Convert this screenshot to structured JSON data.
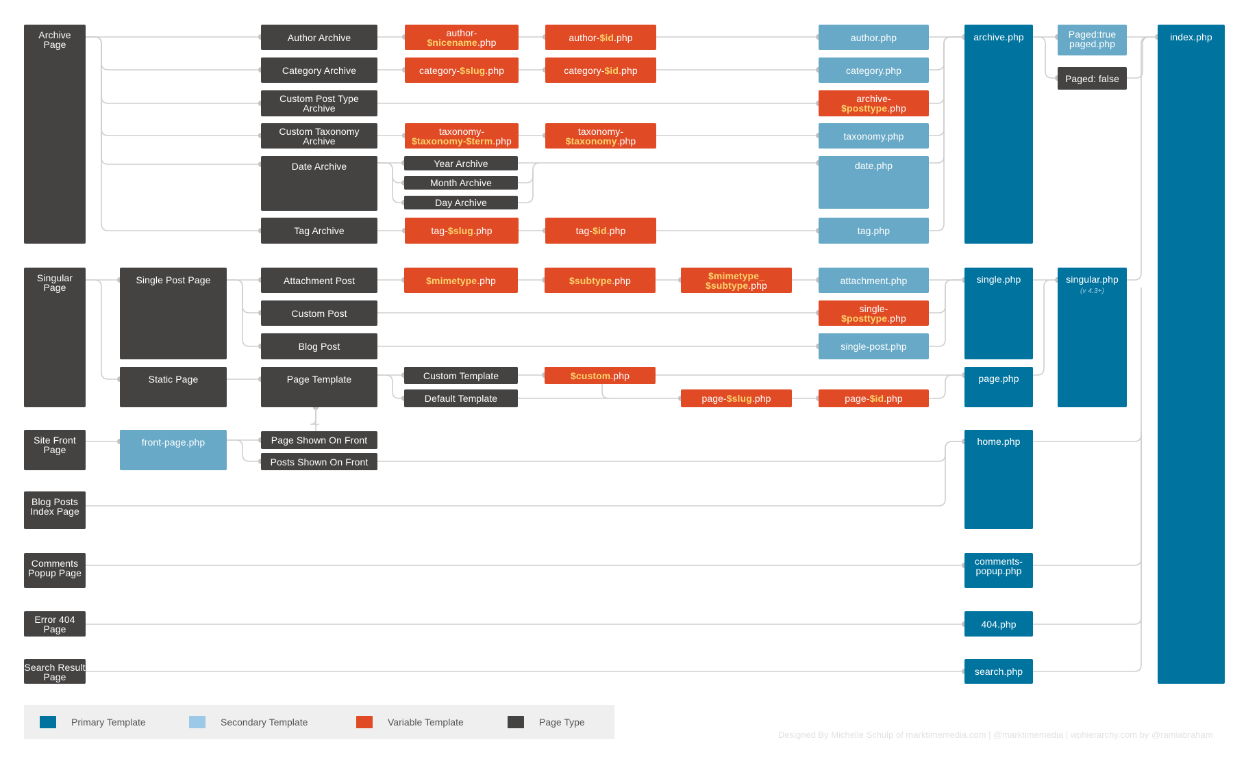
{
  "colors": {
    "primary": "#00739f",
    "secondary": "#67a9c6",
    "variable": "#e04a25",
    "page_type": "#454342",
    "variable_highlight": "#fcd36b",
    "connector": "#cfcfcf"
  },
  "page_types": {
    "archive": [
      "Archive",
      "Page"
    ],
    "singular": [
      "Singular",
      "Page"
    ],
    "site_front": [
      "Site Front",
      "Page"
    ],
    "blog_posts_index": [
      "Blog Posts",
      "Index Page"
    ],
    "comments_popup": [
      "Comments",
      "Popup Page"
    ],
    "error_404": [
      "Error 404",
      "Page"
    ],
    "search_result": [
      "Search Result",
      "Page"
    ]
  },
  "archive_types": {
    "author": "Author Archive",
    "category": "Category Archive",
    "custom_post_type": [
      "Custom Post Type",
      "Archive"
    ],
    "custom_taxonomy": [
      "Custom Taxonomy",
      "Archive"
    ],
    "date": "Date Archive",
    "year": "Year Archive",
    "month": "Month Archive",
    "day": "Day Archive",
    "tag": "Tag Archive"
  },
  "singular_types": {
    "single_post": "Single Post Page",
    "static_page": "Static Page",
    "attachment": "Attachment Post",
    "custom_post": "Custom Post",
    "blog_post": "Blog Post",
    "page_template": "Page Template",
    "custom_template": "Custom Template",
    "default_template": "Default Template"
  },
  "front_types": {
    "page_shown": "Page Shown On Front",
    "posts_shown": "Posts Shown On Front"
  },
  "variable_templates": {
    "author_nicename": {
      "pre": "author-",
      "var": "$nicename",
      "post": ".php"
    },
    "author_id": {
      "pre": "author-",
      "var": "$id",
      "post": ".php"
    },
    "category_slug": {
      "pre": "category-",
      "var": "$slug",
      "post": ".php"
    },
    "category_id": {
      "pre": "category-",
      "var": "$id",
      "post": ".php"
    },
    "archive_posttype": {
      "pre": "archive-",
      "var": "$posttype",
      "post": ".php"
    },
    "taxonomy_term": {
      "pre": "taxonomy-",
      "var": "$taxonomy-$term",
      "post": ".php"
    },
    "taxonomy_tax": {
      "pre": "taxonomy-",
      "var": "$taxonomy",
      "post": ".php"
    },
    "tag_slug": {
      "pre": "tag-",
      "var": "$slug",
      "post": ".php"
    },
    "tag_id": {
      "pre": "tag-",
      "var": "$id",
      "post": ".php"
    },
    "mimetype": {
      "pre": "",
      "var": "$mimetype",
      "post": ".php"
    },
    "subtype": {
      "pre": "",
      "var": "$subtype",
      "post": ".php"
    },
    "mimetype_subtype": {
      "pre": "",
      "var": "$mimetype_",
      "var2": "$subtype",
      "post": ".php"
    },
    "single_posttype": {
      "pre": "single-",
      "var": "$posttype",
      "post": ".php"
    },
    "custom": {
      "pre": "",
      "var": "$custom",
      "post": ".php"
    },
    "page_slug": {
      "pre": "page-",
      "var": "$slug",
      "post": ".php"
    },
    "page_id": {
      "pre": "page-",
      "var": "$id",
      "post": ".php"
    }
  },
  "secondary_templates": {
    "author": "author.php",
    "category": "category.php",
    "taxonomy": "taxonomy.php",
    "date": "date.php",
    "tag": "tag.php",
    "attachment": "attachment.php",
    "single_post": "single-post.php",
    "front_page": "front-page.php",
    "paged_true": [
      "Paged:true",
      "paged.php"
    ]
  },
  "paged_false": "Paged: false",
  "primary_templates": {
    "archive": "archive.php",
    "single": "single.php",
    "page": "page.php",
    "singular": "singular.php",
    "singular_note": "(v 4.3+)",
    "home": "home.php",
    "comments_popup": [
      "comments-",
      "popup.php"
    ],
    "error_404": "404.php",
    "search": "search.php",
    "index": "index.php"
  },
  "legend": [
    {
      "label": "Primary Template",
      "color": "#00739f"
    },
    {
      "label": "Secondary Template",
      "color": "#9dc9e8"
    },
    {
      "label": "Variable Template",
      "color": "#e04a25"
    },
    {
      "label": "Page Type",
      "color": "#454342"
    }
  ],
  "credits": "Designed By Michelle Schulp of marktimemedia.com  |  @marktimemedia  |  wphierarchy.com by @ramiabraham"
}
